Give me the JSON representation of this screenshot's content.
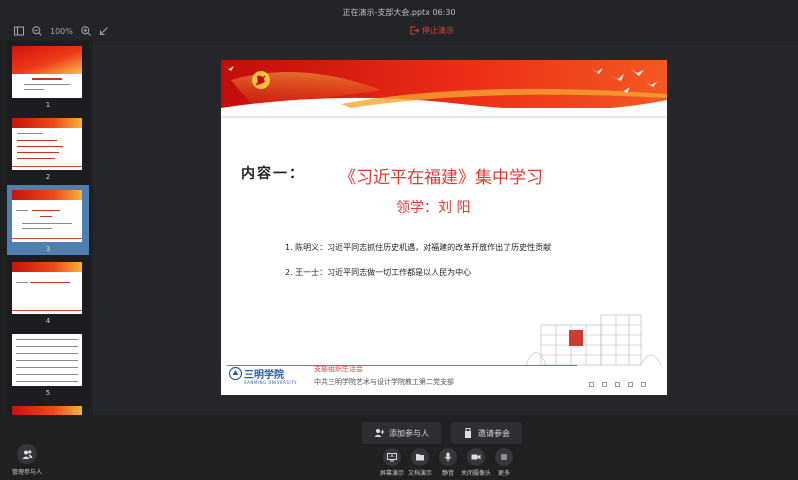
{
  "window": {
    "title": "正在演示-支部大会.pptx 06:30",
    "stop_label": "停止演示"
  },
  "toolbar": {
    "zoom": "100%",
    "icons": [
      "sidebar-toggle-icon",
      "zoom-out-icon",
      "zoom-in-icon",
      "collapse-arrow-icon"
    ]
  },
  "thumbnails": [
    {
      "number": "1",
      "active": false
    },
    {
      "number": "2",
      "active": false
    },
    {
      "number": "3",
      "active": true
    },
    {
      "number": "4",
      "active": false
    },
    {
      "number": "5",
      "active": false
    }
  ],
  "slide": {
    "section": "内容一：",
    "heading": "《习近平在福建》集中学习",
    "leader": "领学：刘 阳",
    "items": [
      "1. 陈明义：习近平同志抓住历史机遇，对福建的改革开放作出了历史性贡献",
      "2. 王一士：习近平同志做一切工作都是以人民为中心"
    ],
    "footer": {
      "logo_cn": "三明学院",
      "logo_en": "SANMING UNIVERSITY",
      "subtitle": "支部组织生活会",
      "org": "中共三明学院艺术与设计学院教工第二党支部"
    }
  },
  "bottom": {
    "add_participant": "添加参与人",
    "invite": "邀请参会",
    "manage": "管理参与人",
    "controls": [
      {
        "label": "屏幕演示",
        "icon": "screen-share-icon"
      },
      {
        "label": "文档演示",
        "icon": "document-share-icon"
      },
      {
        "label": "静音",
        "icon": "microphone-icon"
      },
      {
        "label": "关闭摄像头",
        "icon": "camera-icon"
      },
      {
        "label": "更多",
        "icon": "more-menu-icon"
      }
    ]
  },
  "colors": {
    "accent_red": "#e23a33",
    "active_thumb": "#4f7fb0",
    "background": "#1f2022"
  }
}
